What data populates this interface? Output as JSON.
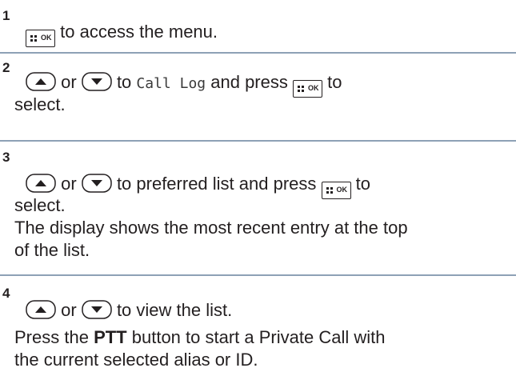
{
  "keys": {
    "ok_label": "OK",
    "up_icon": "up-arrow-key-icon",
    "down_icon": "down-arrow-key-icon",
    "menu_ok_icon": "menu-ok-key-icon"
  },
  "steps": [
    {
      "number": "1",
      "text_a": "to access the menu."
    },
    {
      "number": "2",
      "or": "or",
      "to": "to",
      "menu_item": "Call Log",
      "press": "and press",
      "to2": "to",
      "select": "select."
    },
    {
      "number": "3",
      "or": "or",
      "text_a": "to preferred list and press",
      "to2": "to",
      "select": "select.",
      "note_line1": "The display shows the most recent entry at the top",
      "note_line2": "of the list."
    },
    {
      "number": "4",
      "or": "or",
      "text_a": "to view the list.",
      "press": "Press the",
      "ptt": "PTT",
      "rest": "button to start a Private Call with",
      "line3": "the current selected alias or ID."
    }
  ]
}
